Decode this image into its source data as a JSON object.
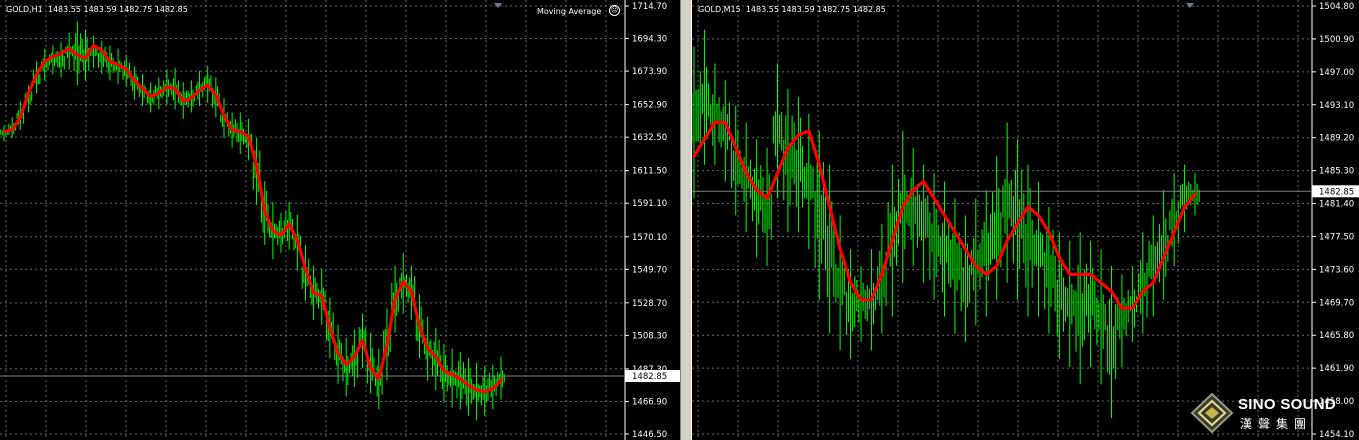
{
  "left_chart": {
    "symbol_header": "GOLD,H1  1483.55 1483.59 1482.75 1482.85",
    "indicator_label": "Moving Average",
    "current_price_label": "1482.85",
    "colors": {
      "background": "#000000",
      "grid": "#5f6b6b",
      "candles": "#00ff00",
      "ma_line": "#ff0000",
      "price_line": "#7f7f7f",
      "axis_text": "#ffffff"
    }
  },
  "right_chart": {
    "symbol_header": "GOLD,M15  1483.55 1483.59 1482.75 1482.85",
    "current_price_label": "1482.85"
  },
  "logo": {
    "name_en": "SINO SOUND",
    "name_cn": "漢聲集團",
    "icon": "diamond-logo-icon"
  },
  "chart_data": [
    {
      "type": "line",
      "title": "GOLD,H1",
      "series_label": "Moving Average",
      "y_ticks": [
        1714.7,
        1694.3,
        1673.9,
        1652.9,
        1632.5,
        1611.5,
        1591.1,
        1570.1,
        1549.7,
        1528.7,
        1508.3,
        1487.3,
        1466.9,
        1446.5
      ],
      "y_tick_labels": [
        "1714.70",
        "1694.30",
        "1673.90",
        "1652.90",
        "1632.50",
        "1611.50",
        "1591.10",
        "1570.10",
        "1549.70",
        "1528.70",
        "1508.30",
        "1487.30",
        "1466.90",
        "1446.50"
      ],
      "ylim": [
        1446.5,
        1714.7
      ],
      "current_price": 1482.85,
      "ma_values": [
        1636,
        1637,
        1645,
        1660,
        1672,
        1680,
        1683,
        1685,
        1688,
        1684,
        1682,
        1690,
        1687,
        1680,
        1678,
        1675,
        1668,
        1663,
        1658,
        1660,
        1664,
        1663,
        1655,
        1657,
        1662,
        1665,
        1659,
        1646,
        1637,
        1636,
        1633,
        1615,
        1586,
        1574,
        1571,
        1578,
        1568,
        1550,
        1535,
        1533,
        1513,
        1497,
        1490,
        1495,
        1505,
        1488,
        1481,
        1502,
        1531,
        1542,
        1536,
        1514,
        1500,
        1495,
        1486,
        1484,
        1481,
        1477,
        1474,
        1473,
        1475,
        1480
      ],
      "price_high_low": [
        [
          1640,
          1630
        ],
        [
          1645,
          1632
        ],
        [
          1655,
          1637
        ],
        [
          1665,
          1648
        ],
        [
          1680,
          1660
        ],
        [
          1688,
          1668
        ],
        [
          1690,
          1672
        ],
        [
          1692,
          1670
        ],
        [
          1698,
          1675
        ],
        [
          1705,
          1665
        ],
        [
          1700,
          1668
        ],
        [
          1696,
          1676
        ],
        [
          1693,
          1672
        ],
        [
          1690,
          1668
        ],
        [
          1688,
          1666
        ],
        [
          1684,
          1664
        ],
        [
          1677,
          1656
        ],
        [
          1672,
          1652
        ],
        [
          1667,
          1648
        ],
        [
          1670,
          1650
        ],
        [
          1675,
          1653
        ],
        [
          1676,
          1650
        ],
        [
          1667,
          1644
        ],
        [
          1668,
          1648
        ],
        [
          1674,
          1652
        ],
        [
          1677,
          1654
        ],
        [
          1670,
          1645
        ],
        [
          1657,
          1632
        ],
        [
          1648,
          1626
        ],
        [
          1648,
          1622
        ],
        [
          1644,
          1618
        ],
        [
          1632,
          1590
        ],
        [
          1605,
          1565
        ],
        [
          1592,
          1556
        ],
        [
          1585,
          1560
        ],
        [
          1592,
          1562
        ],
        [
          1584,
          1549
        ],
        [
          1565,
          1530
        ],
        [
          1552,
          1518
        ],
        [
          1550,
          1515
        ],
        [
          1532,
          1494
        ],
        [
          1515,
          1478
        ],
        [
          1507,
          1470
        ],
        [
          1512,
          1476
        ],
        [
          1522,
          1488
        ],
        [
          1510,
          1472
        ],
        [
          1500,
          1462
        ],
        [
          1525,
          1480
        ],
        [
          1552,
          1510
        ],
        [
          1560,
          1522
        ],
        [
          1552,
          1518
        ],
        [
          1534,
          1494
        ],
        [
          1520,
          1480
        ],
        [
          1513,
          1474
        ],
        [
          1503,
          1466
        ],
        [
          1500,
          1463
        ],
        [
          1498,
          1462
        ],
        [
          1494,
          1458
        ],
        [
          1491,
          1455
        ],
        [
          1489,
          1458
        ],
        [
          1490,
          1462
        ],
        [
          1495,
          1468
        ]
      ]
    },
    {
      "type": "line",
      "title": "GOLD,M15",
      "y_ticks": [
        1504.8,
        1500.9,
        1497.0,
        1493.1,
        1489.2,
        1485.3,
        1481.4,
        1477.5,
        1473.6,
        1469.7,
        1465.8,
        1461.9,
        1458.0,
        1454.1
      ],
      "y_tick_labels": [
        "1504.80",
        "1500.90",
        "1497.00",
        "1493.10",
        "1489.20",
        "1485.30",
        "1481.40",
        "1477.50",
        "1473.60",
        "1469.70",
        "1465.80",
        "1461.90",
        "1458.00",
        "1454.10"
      ],
      "ylim": [
        1454.1,
        1504.8
      ],
      "current_price": 1482.85,
      "ma_values": [
        1487,
        1489,
        1491,
        1491,
        1488,
        1485,
        1483,
        1482,
        1485,
        1488,
        1489.5,
        1490,
        1486,
        1481,
        1476,
        1472,
        1470,
        1470,
        1473,
        1477,
        1481,
        1483,
        1484,
        1482,
        1480,
        1478,
        1476,
        1474,
        1473,
        1474,
        1477,
        1479,
        1481,
        1480,
        1478,
        1475,
        1473,
        1473,
        1473,
        1472,
        1471,
        1469,
        1469,
        1471,
        1472,
        1475,
        1478,
        1481,
        1482.5
      ],
      "price_high_low": [
        [
          1500,
          1482
        ],
        [
          1502,
          1486
        ],
        [
          1498,
          1486
        ],
        [
          1496,
          1484
        ],
        [
          1493,
          1480
        ],
        [
          1491,
          1478
        ],
        [
          1489,
          1475
        ],
        [
          1488,
          1474
        ],
        [
          1498,
          1482
        ],
        [
          1495,
          1478
        ],
        [
          1494,
          1478
        ],
        [
          1492,
          1476
        ],
        [
          1490,
          1470
        ],
        [
          1486,
          1466
        ],
        [
          1480,
          1464
        ],
        [
          1476,
          1463
        ],
        [
          1474,
          1465
        ],
        [
          1476,
          1464
        ],
        [
          1479,
          1466
        ],
        [
          1486,
          1468
        ],
        [
          1490,
          1472
        ],
        [
          1488,
          1474
        ],
        [
          1486,
          1472
        ],
        [
          1485,
          1470
        ],
        [
          1484,
          1468
        ],
        [
          1482,
          1466
        ],
        [
          1480,
          1465
        ],
        [
          1482,
          1467
        ],
        [
          1483,
          1468
        ],
        [
          1487,
          1470
        ],
        [
          1491,
          1472
        ],
        [
          1489,
          1470
        ],
        [
          1486,
          1468
        ],
        [
          1484,
          1468
        ],
        [
          1481,
          1466
        ],
        [
          1478,
          1463
        ],
        [
          1477,
          1462
        ],
        [
          1478,
          1460
        ],
        [
          1477,
          1462
        ],
        [
          1476,
          1460
        ],
        [
          1474,
          1456
        ],
        [
          1473,
          1462
        ],
        [
          1474,
          1465
        ],
        [
          1478,
          1466
        ],
        [
          1480,
          1468
        ],
        [
          1483,
          1470
        ],
        [
          1485,
          1474
        ],
        [
          1486,
          1478
        ],
        [
          1485,
          1480
        ]
      ]
    }
  ]
}
